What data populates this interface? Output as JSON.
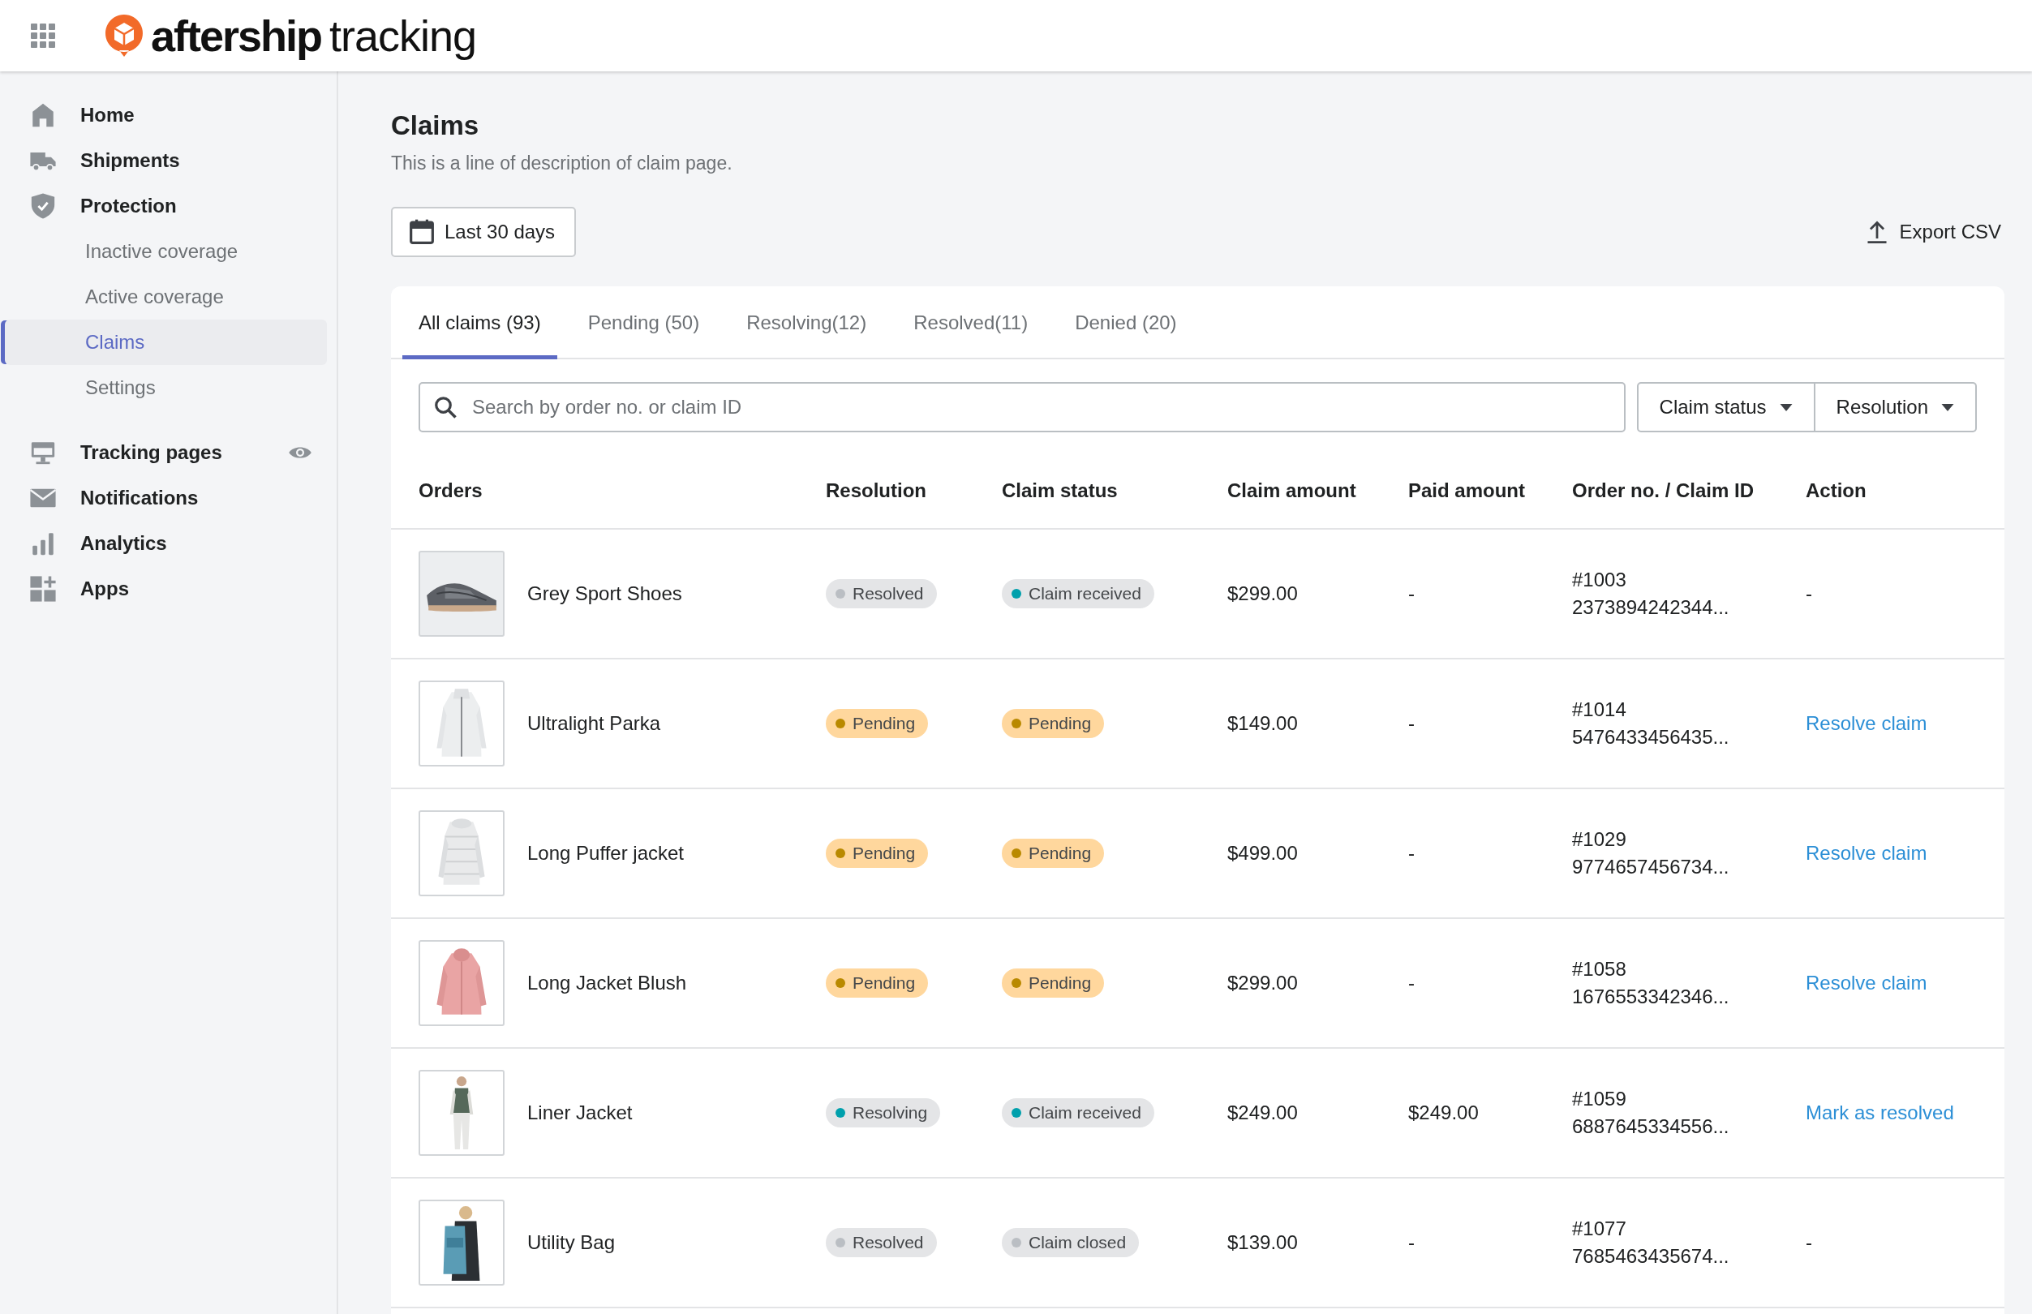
{
  "app_bar": {
    "logo_bold": "aftership",
    "logo_light": "tracking"
  },
  "sidebar": {
    "items": [
      {
        "label": "Home",
        "kind": "home",
        "selected": false,
        "preview": false
      },
      {
        "label": "Shipments",
        "kind": "truck",
        "selected": false,
        "preview": false
      },
      {
        "label": "Protection",
        "kind": "shield",
        "selected": false,
        "preview": false,
        "children": [
          {
            "label": "Inactive coverage",
            "selected": false
          },
          {
            "label": "Active coverage",
            "selected": false
          },
          {
            "label": "Claims",
            "selected": true
          },
          {
            "label": "Settings",
            "selected": false
          }
        ]
      },
      {
        "label": "Tracking pages",
        "kind": "monitor",
        "selected": false,
        "preview": true
      },
      {
        "label": "Notifications",
        "kind": "mail",
        "selected": false,
        "preview": false
      },
      {
        "label": "Analytics",
        "kind": "chart",
        "selected": false,
        "preview": false
      },
      {
        "label": "Apps",
        "kind": "apps",
        "selected": false,
        "preview": false
      }
    ]
  },
  "page": {
    "title": "Claims",
    "description": "This is a line of description of claim page.",
    "date_button": "Last 30 days",
    "export_button": "Export CSV"
  },
  "tabs": [
    {
      "label": "All claims (93)",
      "selected": true
    },
    {
      "label": "Pending (50)",
      "selected": false
    },
    {
      "label": "Resolving(12)",
      "selected": false
    },
    {
      "label": "Resolved(11)",
      "selected": false
    },
    {
      "label": "Denied (20)",
      "selected": false
    }
  ],
  "search": {
    "placeholder": "Search by order no. or claim ID"
  },
  "filters": [
    "Claim status",
    "Resolution"
  ],
  "table": {
    "columns": [
      "Orders",
      "Resolution",
      "Claim status",
      "Claim amount",
      "Paid amount",
      "Order no. / Claim ID",
      "Action"
    ],
    "rows": [
      {
        "product": "Grey Sport Shoes",
        "resolution": {
          "label": "Resolved",
          "kind": "neutral"
        },
        "claim_status": {
          "label": "Claim received",
          "kind": "info"
        },
        "claim_amount": "$299.00",
        "paid_amount": "-",
        "order_no": "#1003",
        "claim_id": "2373894242344...",
        "action": {
          "label": "-",
          "kind": "text"
        }
      },
      {
        "product": "Ultralight Parka",
        "resolution": {
          "label": "Pending",
          "kind": "warning"
        },
        "claim_status": {
          "label": "Pending",
          "kind": "warning"
        },
        "claim_amount": "$149.00",
        "paid_amount": "-",
        "order_no": "#1014",
        "claim_id": "5476433456435...",
        "action": {
          "label": "Resolve claim",
          "kind": "link"
        }
      },
      {
        "product": "Long Puffer jacket",
        "resolution": {
          "label": "Pending",
          "kind": "warning"
        },
        "claim_status": {
          "label": "Pending",
          "kind": "warning"
        },
        "claim_amount": "$499.00",
        "paid_amount": "-",
        "order_no": "#1029",
        "claim_id": "9774657456734...",
        "action": {
          "label": "Resolve claim",
          "kind": "link"
        }
      },
      {
        "product": "Long Jacket Blush",
        "resolution": {
          "label": "Pending",
          "kind": "warning"
        },
        "claim_status": {
          "label": "Pending",
          "kind": "warning"
        },
        "claim_amount": "$299.00",
        "paid_amount": "-",
        "order_no": "#1058",
        "claim_id": "1676553342346...",
        "action": {
          "label": "Resolve claim",
          "kind": "link"
        }
      },
      {
        "product": "Liner Jacket",
        "resolution": {
          "label": "Resolving",
          "kind": "info"
        },
        "claim_status": {
          "label": "Claim received",
          "kind": "info"
        },
        "claim_amount": "$249.00",
        "paid_amount": "$249.00",
        "order_no": "#1059",
        "claim_id": "6887645334556...",
        "action": {
          "label": "Mark as resolved",
          "kind": "link"
        }
      },
      {
        "product": "Utility Bag",
        "resolution": {
          "label": "Resolved",
          "kind": "neutral"
        },
        "claim_status": {
          "label": "Claim closed",
          "kind": "neutral"
        },
        "claim_amount": "$139.00",
        "paid_amount": "-",
        "order_no": "#1077",
        "claim_id": "7685463435674...",
        "action": {
          "label": "-",
          "kind": "text"
        }
      }
    ]
  }
}
